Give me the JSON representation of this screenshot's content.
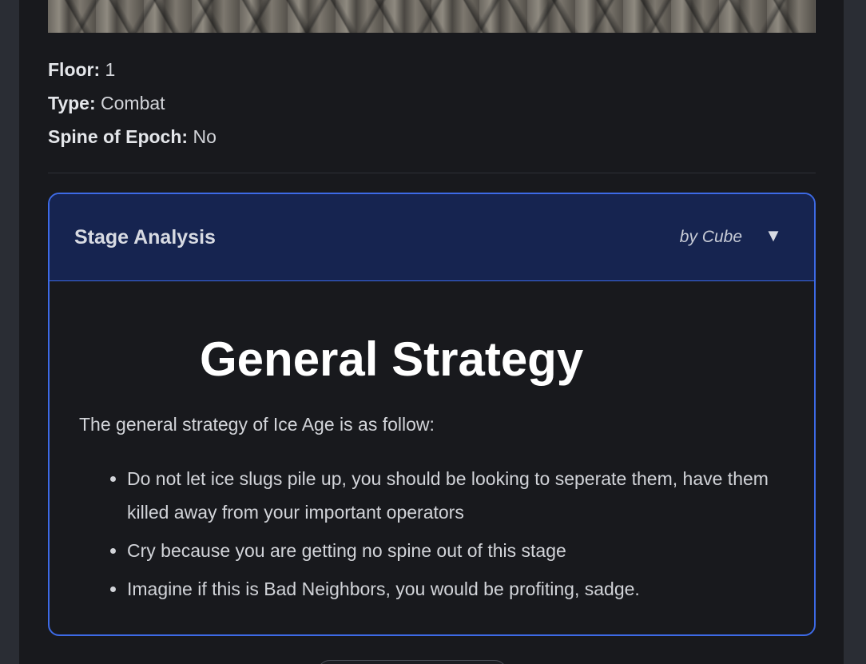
{
  "stage": {
    "floor_label": "Floor:",
    "floor_value": "1",
    "type_label": "Type:",
    "type_value": "Combat",
    "spine_label": "Spine of Epoch:",
    "spine_value": "No"
  },
  "analysis": {
    "title": "Stage Analysis",
    "author": "by Cube",
    "toggle_icon": "chevron-down-icon",
    "heading": "General Strategy",
    "intro": "The general strategy of Ice Age is as follow:",
    "bullets": [
      "Do not let ice slugs pile up, you should be looking to seperate them, have them killed away from your important operators",
      "Cry because you are getting no spine out of this stage",
      "Imagine if this is Bad Neighbors, you would be profiting, sadge."
    ]
  },
  "colors": {
    "accent_border": "#3d6ae6",
    "header_bg": "#162450",
    "panel_bg": "#18191d"
  }
}
